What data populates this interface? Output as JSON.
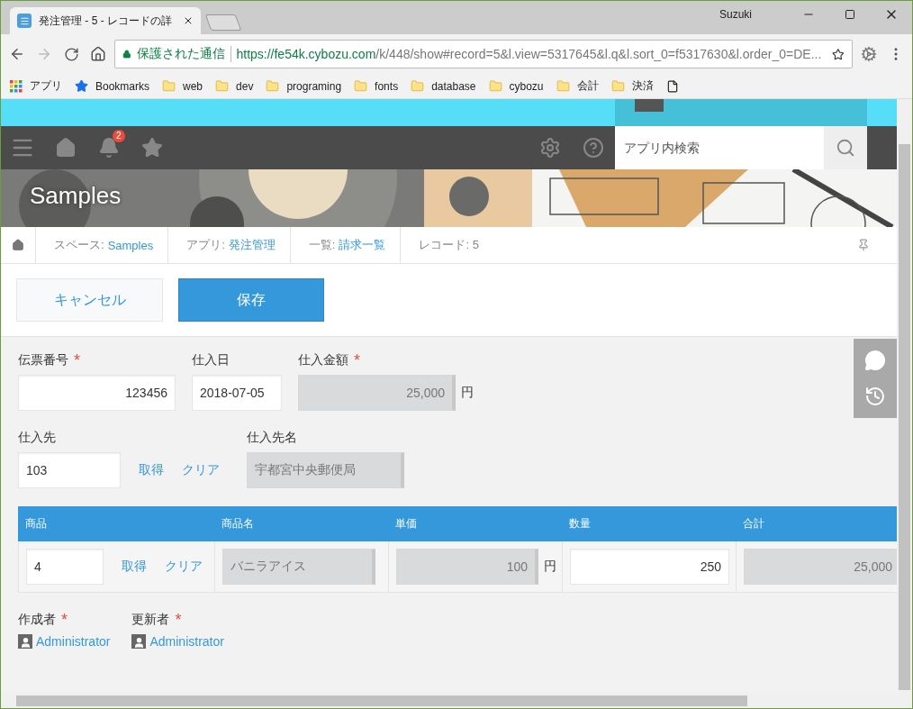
{
  "browser": {
    "user": "Suzuki",
    "tab_title": "発注管理 - 5 - レコードの詳",
    "secure_label": "保護された通信",
    "url_host": "https://fe54k.cybozu.com",
    "url_path": "/k/448/show#record=5&l.view=5317645&l.q&l.sort_0=f5317630&l.order_0=DE...",
    "bookmarks": [
      {
        "kind": "apps",
        "label": "アプリ"
      },
      {
        "kind": "star",
        "label": "Bookmarks"
      },
      {
        "kind": "folder",
        "label": "web"
      },
      {
        "kind": "folder",
        "label": "dev"
      },
      {
        "kind": "folder",
        "label": "programing"
      },
      {
        "kind": "folder",
        "label": "fonts"
      },
      {
        "kind": "folder",
        "label": "database"
      },
      {
        "kind": "folder",
        "label": "cybozu"
      },
      {
        "kind": "folder",
        "label": "会計"
      },
      {
        "kind": "folder",
        "label": "決済"
      }
    ]
  },
  "required_mark": "*",
  "nav": {
    "badge": "2",
    "search_placeholder": "アプリ内検索"
  },
  "banner": {
    "title": "Samples"
  },
  "breadcrumb": [
    {
      "prefix": "スペース:",
      "link": "Samples"
    },
    {
      "prefix": "アプリ:",
      "link": "発注管理"
    },
    {
      "prefix": "一覧:",
      "link": "請求一覧"
    },
    {
      "prefix": "レコード: 5"
    }
  ],
  "actions": {
    "cancel": "キャンセル",
    "save": "保存"
  },
  "form_rows": [
    [
      {
        "kind": "number",
        "label": "伝票番号",
        "required": true,
        "value": "123456",
        "disabled": false
      },
      {
        "kind": "date",
        "label": "仕入日",
        "required": false,
        "value": "2018-07-05",
        "disabled": false
      },
      {
        "kind": "number",
        "label": "仕入金額",
        "required": true,
        "value": "25,000",
        "unit": "円",
        "disabled": true
      }
    ],
    [
      {
        "kind": "lookup",
        "label": "仕入先",
        "required": false,
        "value": "103",
        "disabled": false,
        "actions": [
          "取得",
          "クリア"
        ]
      },
      {
        "kind": "text",
        "label": "仕入先名",
        "required": false,
        "value": "宇都宮中央郵便局",
        "disabled": true
      }
    ]
  ],
  "table": {
    "columns": [
      "商品",
      "商品名",
      "単価",
      "数量",
      "合計"
    ],
    "rows": [
      [
        {
          "kind": "lookup",
          "value": "4",
          "disabled": false,
          "actions": [
            "取得",
            "クリア"
          ]
        },
        {
          "kind": "text",
          "value": "バニラアイス",
          "disabled": true
        },
        {
          "kind": "number",
          "value": "100",
          "unit": "円",
          "disabled": true
        },
        {
          "kind": "number",
          "value": "250",
          "disabled": false
        },
        {
          "kind": "number",
          "value": "25,000",
          "disabled": true
        }
      ]
    ]
  },
  "users": [
    {
      "label": "作成者",
      "required": true,
      "name": "Administrator"
    },
    {
      "label": "更新者",
      "required": true,
      "name": "Administrator"
    }
  ]
}
